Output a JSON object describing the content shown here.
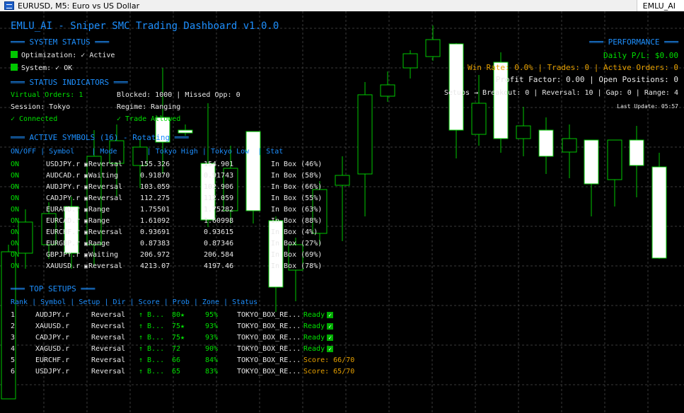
{
  "window": {
    "title": "EURUSD, M5:  Euro vs US Dollar",
    "indicator_badge": "EMLU_AI"
  },
  "dashboard": {
    "title": "EMLU_AI - Sniper SMC Trading Dashboard v1.0.0",
    "system_status": {
      "header": "SYSTEM STATUS",
      "optimization": "Optimization: ✓ Active",
      "system": "System: ✓ OK"
    },
    "status_indicators": {
      "header": "STATUS INDICATORS",
      "virtual_orders": "Virtual Orders: 1",
      "blocked": "Blocked: 1000 | Missed Opp: 0",
      "session": "Session: Tokyo",
      "regime": "Regime: Ranging",
      "connected": "✓ Connected",
      "trade_allowed": "✓ Trade Allowed"
    },
    "performance": {
      "header": "PERFORMANCE",
      "daily_pl": "Daily P/L: $0.00",
      "winrate": "Win Rate: 0.0% | Trades: 0 | Active Orders: 0",
      "profit_factor": "Profit Factor: 0.00 | Open Positions: 0",
      "setups": "Setups → Breakout: 0 | Reversal: 10 | Gap: 0 | Range: 4",
      "last_update": "Last Update: 05:57"
    },
    "active_symbols": {
      "header": "ACTIVE SYMBOLS (16) - Rotating",
      "columns": "ON/OFF | Symbol    | Mode       | Tokyo High | Tokyo Low  | Stat",
      "rows": [
        {
          "on": "ON",
          "symbol": "USDJPY.r",
          "mode": "Reversal",
          "high": "155.326",
          "low": "154.901",
          "stat": "In Box (46%)"
        },
        {
          "on": "ON",
          "symbol": "AUDCAD.r",
          "mode": "Waiting",
          "high": "0.91870",
          "low": "0.91743",
          "stat": "In Box (58%)"
        },
        {
          "on": "ON",
          "symbol": "AUDJPY.r",
          "mode": "Reversal",
          "high": "103.059",
          "low": "102.906",
          "stat": "In Box (66%)"
        },
        {
          "on": "ON",
          "symbol": "CADJPY.r",
          "mode": "Reversal",
          "high": "112.275",
          "low": "112.059",
          "stat": "In Box (55%)"
        },
        {
          "on": "ON",
          "symbol": "EURAUD.r",
          "mode": "Range",
          "high": "1.75501",
          "low": "1.75282",
          "stat": "In Box (63%)"
        },
        {
          "on": "ON",
          "symbol": "EURCAD.r",
          "mode": "Range",
          "high": "1.61092",
          "low": "1.60998",
          "stat": "In Box (88%)"
        },
        {
          "on": "ON",
          "symbol": "EURCHF.r",
          "mode": "Reversal",
          "high": "0.93691",
          "low": "0.93615",
          "stat": "In Box (4%)"
        },
        {
          "on": "ON",
          "symbol": "EURGBP.r",
          "mode": "Range",
          "high": "0.87383",
          "low": "0.87346",
          "stat": "In Box (27%)"
        },
        {
          "on": "ON",
          "symbol": "GBPJPY.r",
          "mode": "Waiting",
          "high": "206.972",
          "low": "206.584",
          "stat": "In Box (69%)"
        },
        {
          "on": "ON",
          "symbol": "XAUUSD.r",
          "mode": "Reversal",
          "high": "4213.07",
          "low": "4197.46",
          "stat": "In Box (78%)"
        }
      ]
    },
    "top_setups": {
      "header": "TOP SETUPS",
      "columns": "Rank | Symbol | Setup | Dir | Score | Prob | Zone | Status",
      "rows": [
        {
          "rank": "1",
          "symbol": "AUDJPY.r",
          "setup": "Reversal",
          "dir": "↑ B...",
          "score": "80★",
          "prob": "95%",
          "zone": "TOKYO_BOX_RE...",
          "status": "Ready",
          "ready": true
        },
        {
          "rank": "2",
          "symbol": "XAUUSD.r",
          "setup": "Reversal",
          "dir": "↑ B...",
          "score": "75★",
          "prob": "93%",
          "zone": "TOKYO_BOX_RE...",
          "status": "Ready",
          "ready": true
        },
        {
          "rank": "3",
          "symbol": "CADJPY.r",
          "setup": "Reversal",
          "dir": "↑ B...",
          "score": "75★",
          "prob": "93%",
          "zone": "TOKYO_BOX_RE...",
          "status": "Ready",
          "ready": true
        },
        {
          "rank": "4",
          "symbol": "XAGUSD.r",
          "setup": "Reversal",
          "dir": "↑ B...",
          "score": "72",
          "prob": "90%",
          "zone": "TOKYO_BOX_RE...",
          "status": "Ready",
          "ready": true
        },
        {
          "rank": "5",
          "symbol": "EURCHF.r",
          "setup": "Reversal",
          "dir": "↑ B...",
          "score": "66",
          "prob": "84%",
          "zone": "TOKYO_BOX_RE...",
          "status": "Score: 66/70",
          "ready": false
        },
        {
          "rank": "6",
          "symbol": "USDJPY.r",
          "setup": "Reversal",
          "dir": "↑ B...",
          "score": "65",
          "prob": "83%",
          "zone": "TOKYO_BOX_RE...",
          "status": "Score: 65/70",
          "ready": false
        }
      ]
    }
  },
  "colors": {
    "background": "#000000",
    "bull_candle": "#000000",
    "bear_candle": "#ffffff",
    "wick": "#00c800",
    "grid": "#3a3a3a",
    "header": "#1e90ff",
    "green_text": "#00e000",
    "orange_text": "#e6a000"
  }
}
